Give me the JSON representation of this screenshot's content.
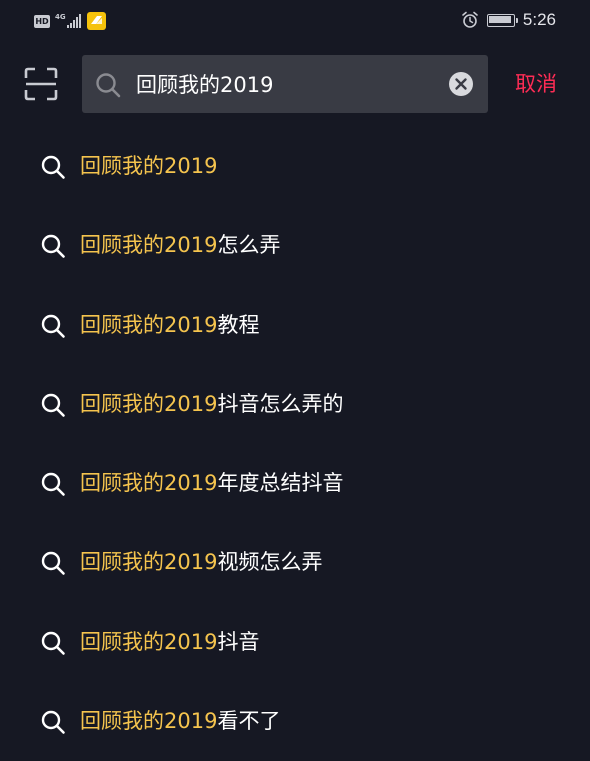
{
  "status_bar": {
    "hd_label": "HD",
    "network_label": "4G",
    "time": "5:26"
  },
  "search": {
    "value": "回顾我的2019",
    "cancel_label": "取消"
  },
  "colors": {
    "background": "#161823",
    "search_box": "#393b44",
    "highlight": "#f5c44e",
    "cancel": "#fe2c55",
    "text": "#ffffff"
  },
  "suggestions": [
    {
      "highlight": "回顾我的2019",
      "rest": ""
    },
    {
      "highlight": "回顾我的2019",
      "rest": "怎么弄"
    },
    {
      "highlight": "回顾我的2019",
      "rest": "教程"
    },
    {
      "highlight": "回顾我的2019",
      "rest": "抖音怎么弄的"
    },
    {
      "highlight": "回顾我的2019",
      "rest": "年度总结抖音"
    },
    {
      "highlight": "回顾我的2019",
      "rest": "视频怎么弄"
    },
    {
      "highlight": "回顾我的2019",
      "rest": "抖音"
    },
    {
      "highlight": "回顾我的2019",
      "rest": "看不了"
    }
  ],
  "icons": {
    "scan": "scan-icon",
    "search": "search-icon",
    "clear": "clear-icon",
    "alarm": "alarm-icon",
    "battery": "battery-icon"
  }
}
